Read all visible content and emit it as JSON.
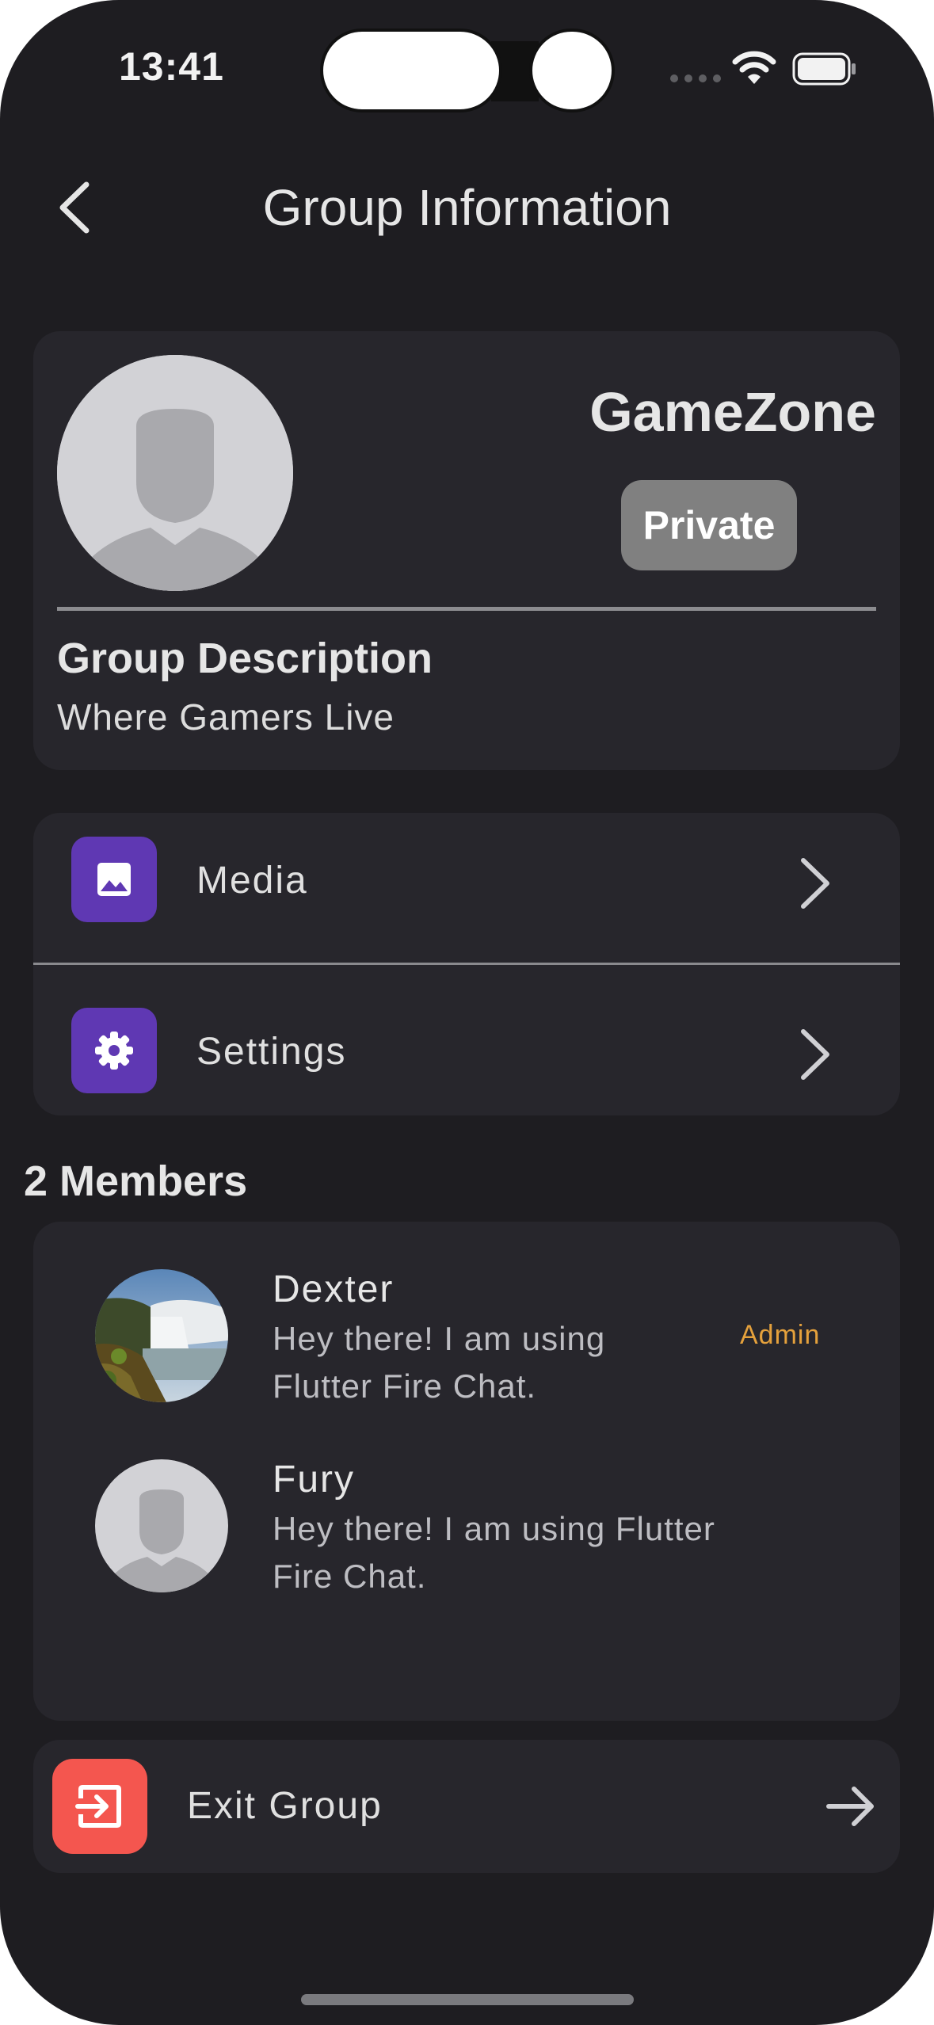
{
  "status_bar": {
    "time": "13:41"
  },
  "header": {
    "title": "Group Information",
    "back_icon": "chevron-left-icon"
  },
  "group": {
    "name": "GameZone",
    "privacy_badge": "Private",
    "description_title": "Group Description",
    "description": "Where Gamers Live"
  },
  "menu": {
    "items": [
      {
        "label": "Media",
        "icon": "image-icon"
      },
      {
        "label": "Settings",
        "icon": "gear-icon"
      }
    ]
  },
  "members": {
    "title": "2 Members",
    "list": [
      {
        "name": "Dexter",
        "status": "Hey there! I am using Flutter Fire Chat.",
        "status_line1": "Hey there! I am using",
        "status_line2": "Flutter Fire Chat.",
        "role": "Admin"
      },
      {
        "name": "Fury",
        "status": "Hey there! I am using Flutter Fire Chat.",
        "status_line1": "Hey there! I am using Flutter",
        "status_line2": "Fire Chat."
      }
    ]
  },
  "exit": {
    "label": "Exit Group",
    "icon": "exit-icon"
  },
  "colors": {
    "background": "#1e1d21",
    "card": "#27262c",
    "accent_purple": "#5f38b3",
    "exit_red": "#f4564f",
    "admin_orange": "#e5a13c",
    "badge_gray": "#808080"
  }
}
